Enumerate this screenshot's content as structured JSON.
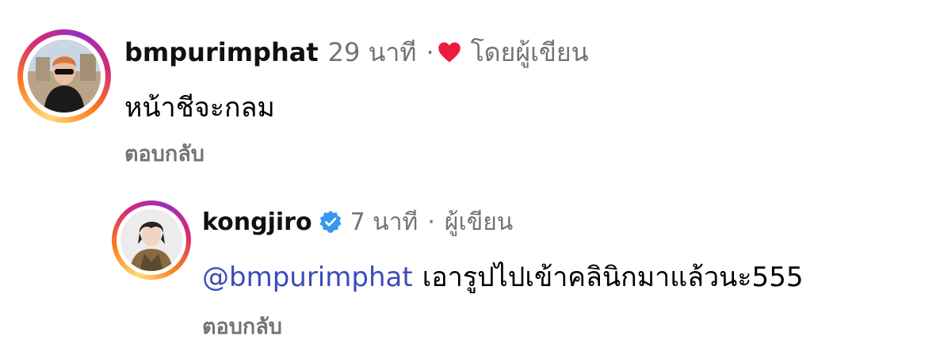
{
  "comments": [
    {
      "username": "bmpurimphat",
      "time": "29 นาที",
      "separator": "·",
      "liked_by_author_label": "โดยผู้เขียน",
      "text": "หน้าชีจะกลม",
      "reply_label": "ตอบกลับ",
      "icons": {
        "like": "heart-icon"
      },
      "colors": {
        "heart": "#ed1c3f"
      }
    },
    {
      "username": "kongjiro",
      "verified": true,
      "time": "7 นาที",
      "separator": "·",
      "author_label": "ผู้เขียน",
      "mention": "@bmpurimphat",
      "text": "เอารูปไปเข้าคลินิกมาแล้วนะ555",
      "reply_label": "ตอบกลับ",
      "icons": {
        "verified": "verified-badge-icon"
      },
      "colors": {
        "verified": "#3897f0",
        "mention": "#3b4cb8"
      }
    }
  ]
}
